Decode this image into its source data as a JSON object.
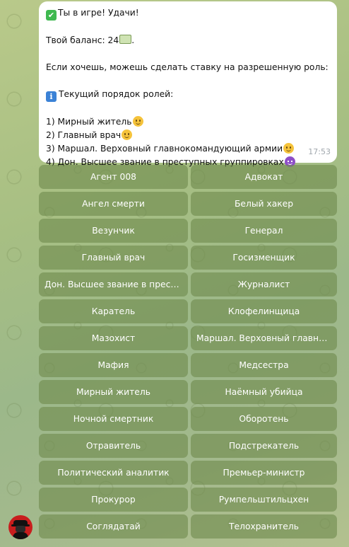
{
  "message": {
    "line1": "Ты в игре! Удачи!",
    "balance_prefix": "Твой баланс: 24",
    "balance_suffix": ".",
    "bet_text": "Если хочешь, можешь сделать ставку на разрешенную роль:",
    "order_title": "Текущий порядок ролей:",
    "roles": [
      "1) Мирный житель",
      "2) Главный врач",
      "3) Маршал. Верховный главнокомандующий армии",
      "4) Дон. Высшее звание в преступных группировках"
    ],
    "time": "17:53"
  },
  "keyboard": [
    "Агент 008",
    "Адвокат",
    "Ангел смерти",
    "Белый хакер",
    "Везунчик",
    "Генерал",
    "Главный врач",
    "Госизменщик",
    "Дон. Высшее звание в преступных группировках",
    "Журналист",
    "Каратель",
    "Клофелинщица",
    "Мазохист",
    "Маршал. Верховный главнокомандующий армии",
    "Мафия",
    "Медсестра",
    "Мирный житель",
    "Наёмный убийца",
    "Ночной смертник",
    "Оборотень",
    "Отравитель",
    "Подстрекатель",
    "Политический аналитик",
    "Премьер-министр",
    "Прокурор",
    "Румпельштильцхен",
    "Соглядатай",
    "Телохранитель"
  ],
  "icons": {
    "check": "check-mark-icon",
    "money": "money-icon",
    "info": "info-icon",
    "smile": "smiling-face-icon",
    "devil": "smiling-devil-icon"
  },
  "colors": {
    "bubble": "#ffffff",
    "button": "#708a4e",
    "avatar": "#c81d1d"
  }
}
